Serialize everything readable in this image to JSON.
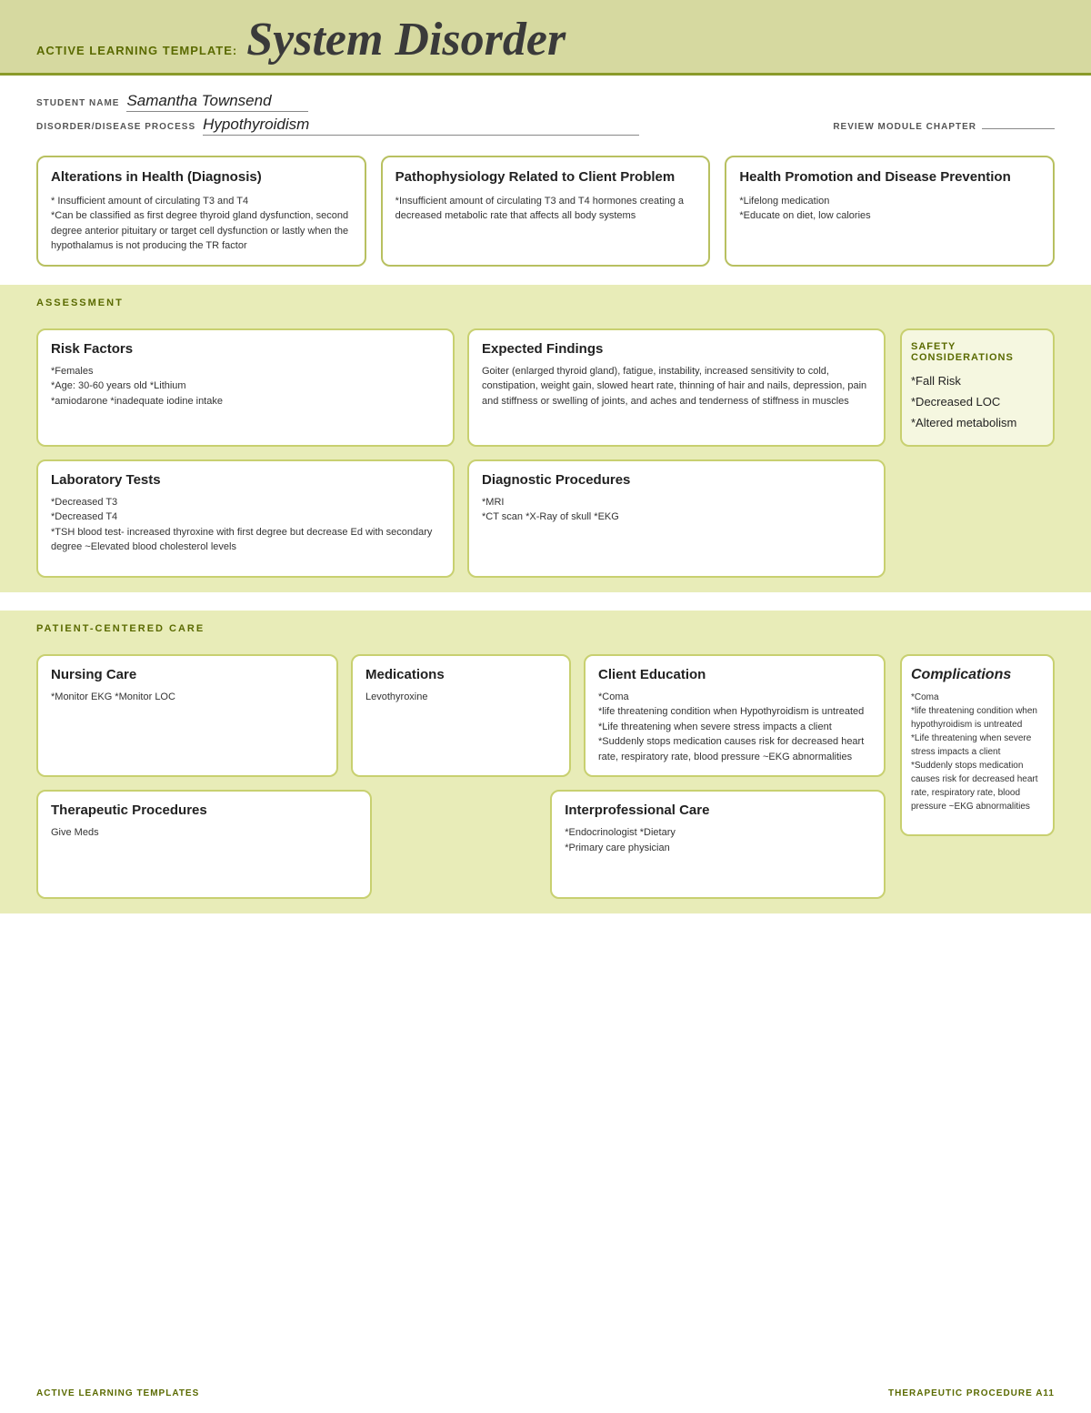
{
  "header": {
    "prefix": "ACTIVE LEARNING TEMPLATE:",
    "title": "System Disorder"
  },
  "student": {
    "name_label": "STUDENT NAME",
    "name_value": "Samantha Townsend",
    "disorder_label": "DISORDER/DISEASE PROCESS",
    "disorder_value": "Hypothyroidism",
    "review_label": "REVIEW MODULE CHAPTER"
  },
  "top_boxes": [
    {
      "title": "Alterations in Health (Diagnosis)",
      "content": "* Insufficient amount of circulating T3 and T4\n*Can be classified as first degree thyroid gland dysfunction, second degree anterior pituitary or target cell dysfunction or lastly when the hypothalamus is not producing the TR factor"
    },
    {
      "title": "Pathophysiology Related to Client Problem",
      "content": "*Insufficient amount of circulating T3 and T4 hormones creating a decreased metabolic rate that affects all body systems"
    },
    {
      "title": "Health Promotion and Disease Prevention",
      "content": "*Lifelong medication\n*Educate on diet, low calories"
    }
  ],
  "assessment": {
    "label": "ASSESSMENT",
    "safety_label": "SAFETY\nCONSIDERATIONS",
    "risk_factors": {
      "title": "Risk Factors",
      "content": "*Females\n*Age: 30-60 years old *Lithium\n*amiodarone *inadequate iodine intake"
    },
    "expected_findings": {
      "title": "Expected Findings",
      "content": "Goiter (enlarged thyroid gland), fatigue, instability, increased sensitivity to cold, constipation, weight gain, slowed heart rate, thinning of hair and nails, depression, pain and stiffness or swelling of joints, and aches and tenderness of stiffness in muscles"
    },
    "laboratory_tests": {
      "title": "Laboratory Tests",
      "content": "*Decreased T3\n*Decreased T4\n*TSH blood test- increased thyroxine with first degree but decrease Ed with secondary degree ~Elevated blood cholesterol levels"
    },
    "diagnostic_procedures": {
      "title": "Diagnostic Procedures",
      "content": "*MRI\n*CT scan *X-Ray of skull *EKG"
    },
    "safety_content": "*Fall Risk\n*Decreased LOC\n*Altered metabolism"
  },
  "patient_care": {
    "label": "PATIENT-CENTERED CARE",
    "nursing_care": {
      "title": "Nursing Care",
      "content": "*Monitor EKG *Monitor LOC"
    },
    "medications": {
      "title": "Medications",
      "content": "Levothyroxine"
    },
    "client_education": {
      "title": "Client Education",
      "content": "*Coma\n*life threatening condition when Hypothyroidism is untreated\n*Life threatening when severe stress impacts a client\n*Suddenly stops medication causes risk for decreased heart rate, respiratory rate, blood pressure ~EKG abnormalities"
    },
    "therapeutic_procedures": {
      "title": "Therapeutic Procedures",
      "content": "Give Meds"
    },
    "interprofessional_care": {
      "title": "Interprofessional Care",
      "content": "*Endocrinologist *Dietary\n*Primary care physician"
    }
  },
  "complications": {
    "title": "Complications",
    "content": "*Coma\n*life threatening condition when hypothyroidism is untreated\n*Life threatening when severe stress impacts a client\n*Suddenly stops medication causes risk for decreased heart rate, respiratory rate, blood pressure ~EKG abnormalities"
  },
  "footer": {
    "left": "ACTIVE LEARNING TEMPLATES",
    "right": "THERAPEUTIC PROCEDURE  A11"
  }
}
